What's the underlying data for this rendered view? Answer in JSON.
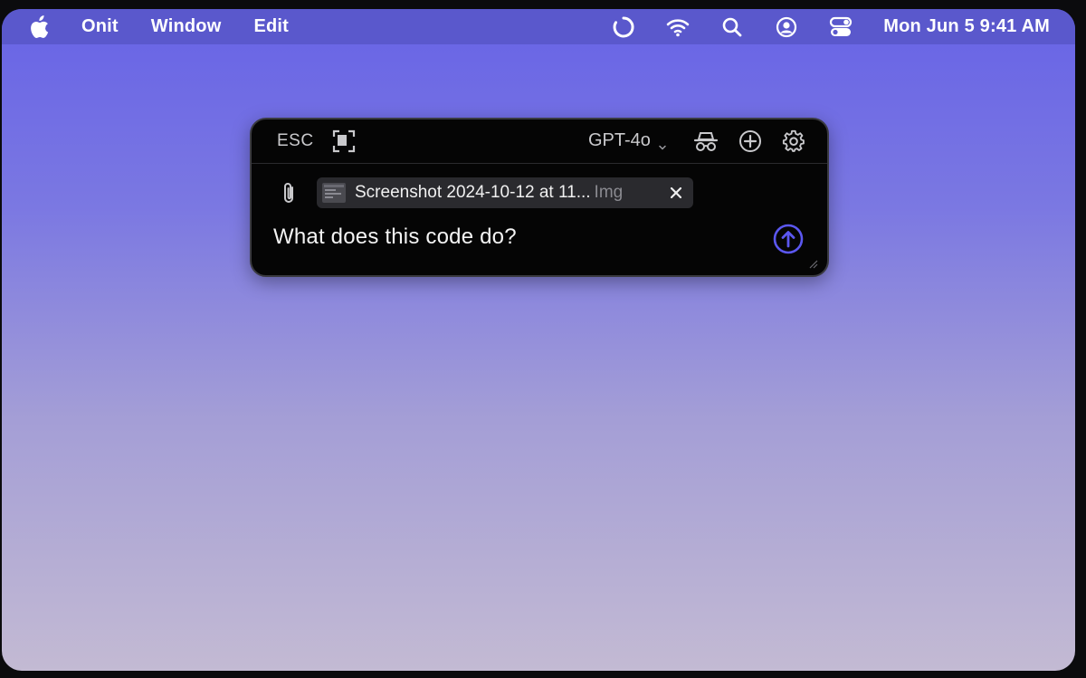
{
  "menubar": {
    "apple_icon": "apple-logo-icon",
    "items": [
      {
        "label": "Onit"
      },
      {
        "label": "Window"
      },
      {
        "label": "Edit"
      }
    ],
    "status_icons": [
      "loading-spinner-icon",
      "wifi-icon",
      "search-icon",
      "user-account-icon",
      "control-center-icon"
    ],
    "clock": "Mon Jun 5  9:41 AM"
  },
  "panel": {
    "esc_label": "ESC",
    "select_region_icon": "screen-region-icon",
    "model_label": "GPT-4o",
    "model_chevron_icon": "chevron-down-icon",
    "toolbar_icons": [
      "incognito-icon",
      "new-chat-plus-icon",
      "settings-gear-icon"
    ],
    "attach_icon": "paperclip-icon",
    "attachment": {
      "thumbnail_icon": "image-thumbnail-icon",
      "name": "Screenshot 2024-10-12 at 11...",
      "type": "Img",
      "close_icon": "close-icon"
    },
    "prompt_text": "What does this code do?",
    "send_icon": "send-arrow-up-icon",
    "accent_color": "#5b57f0"
  }
}
